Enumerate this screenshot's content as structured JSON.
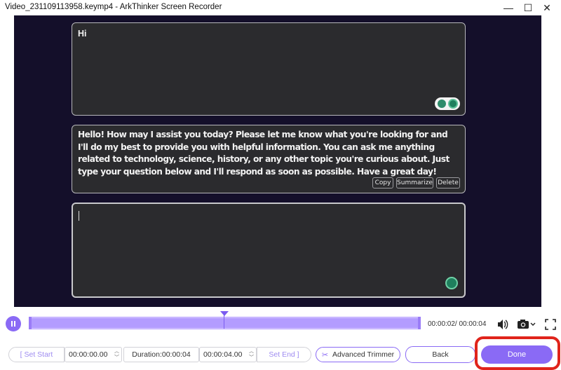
{
  "window": {
    "title": "Video_231109113958.keymp4  -  ArkThinker Screen Recorder",
    "minimize_glyph": "—",
    "maximize_glyph": "☐",
    "close_glyph": "✕"
  },
  "chat": {
    "user_message": "Hi",
    "assistant_message": "Hello! How may I assist you today? Please let me know what you're looking for and I'll do my best to provide you with helpful information. You can ask me anything related to technology, science, history, or any other topic you're curious about. Just type your question below and I'll respond as soon as possible. Have a great day!",
    "actions": [
      "Copy",
      "Summarize",
      "Delete"
    ],
    "input_value": ""
  },
  "player": {
    "progress_fraction": 0.5,
    "time_readout": "00:00:02/ 00:00:04",
    "icons": [
      "pause-icon",
      "volume-icon",
      "camera-icon",
      "fullscreen-icon"
    ]
  },
  "trim": {
    "set_start_label": "[  Set Start",
    "start_value": "00:00:00.00",
    "duration_label": "Duration:00:00:04",
    "end_value": "00:00:04.00",
    "set_end_label": "Set End  ]",
    "advanced_trimmer_label": "Advanced Trimmer",
    "back_label": "Back",
    "done_label": "Done"
  },
  "colors": {
    "accent": "#8a6af5",
    "highlight": "#e0241b",
    "video_bg": "#140f2a",
    "panel_bg": "#2b2b2e"
  }
}
